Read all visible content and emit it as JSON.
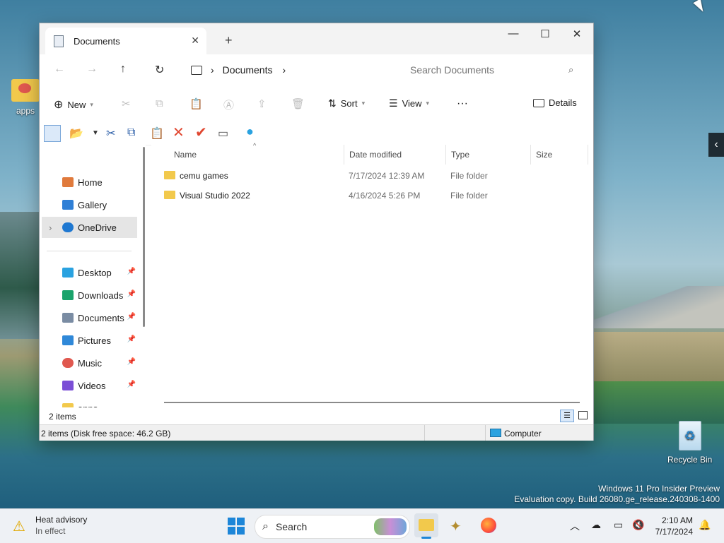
{
  "desktop": {
    "icons": [
      {
        "label": "apps",
        "icon": "folder-icon"
      },
      {
        "label": "Recycle Bin",
        "icon": "recycle-bin-icon"
      }
    ],
    "watermark_line1": "Windows 11 Pro Insider Preview",
    "watermark_line2": "Evaluation copy. Build 26080.ge_release.240308-1400"
  },
  "window": {
    "tab_title": "Documents",
    "new_tab": "+",
    "controls": {
      "minimize": "—",
      "maximize": "☐",
      "close": "✕"
    },
    "breadcrumb": {
      "location": "Documents"
    },
    "search_placeholder": "Search Documents",
    "toolbar": {
      "new_label": "New",
      "sort_label": "Sort",
      "view_label": "View",
      "more_label": "···",
      "details_label": "Details"
    },
    "nav": {
      "items": [
        {
          "label": "Home",
          "icon": "home-icon",
          "color": "#e07a3c"
        },
        {
          "label": "Gallery",
          "icon": "gallery-icon",
          "color": "#2f7fd6"
        },
        {
          "label": "OneDrive",
          "icon": "onedrive-icon",
          "color": "#1f78d1"
        },
        {
          "label": "Desktop",
          "icon": "desktop-icon",
          "color": "#2aa2e0"
        },
        {
          "label": "Downloads",
          "icon": "downloads-icon",
          "color": "#1aa36b"
        },
        {
          "label": "Documents",
          "icon": "documents-icon",
          "color": "#7a8ca3"
        },
        {
          "label": "Pictures",
          "icon": "pictures-icon",
          "color": "#2f88d8"
        },
        {
          "label": "Music",
          "icon": "music-icon",
          "color": "#e0584f"
        },
        {
          "label": "Videos",
          "icon": "videos-icon",
          "color": "#7b4ed6"
        },
        {
          "label": "apps",
          "icon": "folder-icon",
          "color": "#f2c94c"
        }
      ]
    },
    "columns": [
      "Name",
      "Date modified",
      "Type",
      "Size"
    ],
    "files": [
      {
        "name": "cemu games",
        "date": "7/17/2024 12:39 AM",
        "type": "File folder",
        "size": ""
      },
      {
        "name": "Visual Studio 2022",
        "date": "4/16/2024 5:26 PM",
        "type": "File folder",
        "size": ""
      }
    ],
    "item_count": "2 items",
    "status_left": "2 items (Disk free space: 46.2 GB)",
    "status_right": "Computer"
  },
  "taskbar": {
    "weather_title": "Heat advisory",
    "weather_sub": "In effect",
    "search_label": "Search",
    "time": "2:10 AM",
    "date": "7/17/2024"
  }
}
